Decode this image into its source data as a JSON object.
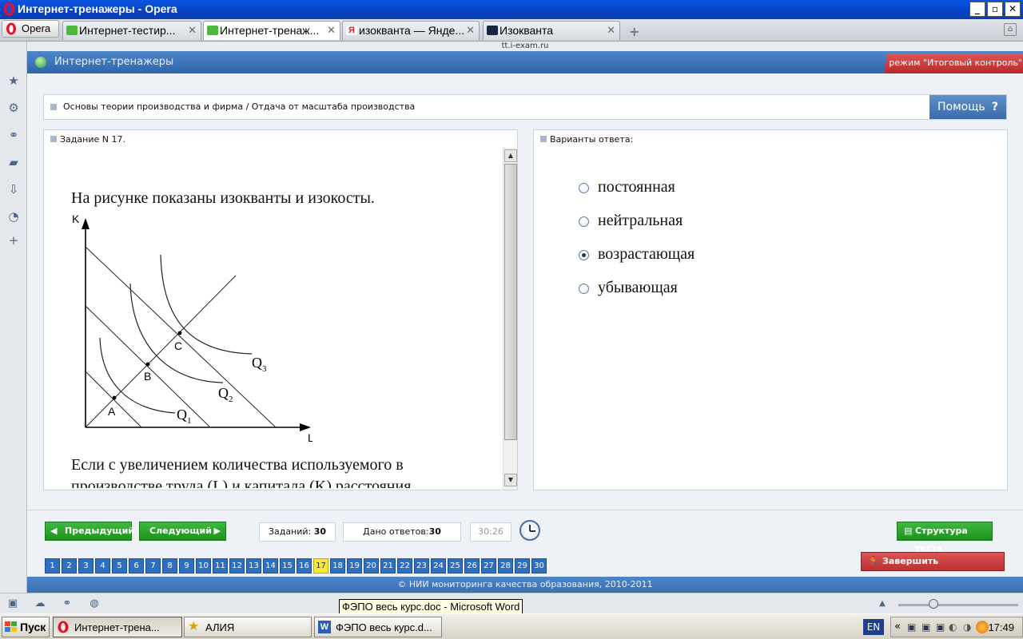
{
  "window": {
    "title": "Интернет-тренажеры - Opera",
    "controls": [
      "_",
      "▫",
      "✕"
    ]
  },
  "browser": {
    "menu_label": "Opera",
    "tabs": [
      {
        "label": "Интернет-тестир...",
        "icon": "green-page-icon"
      },
      {
        "label": "Интернет-тренаж...",
        "icon": "green-page-icon",
        "active": true
      },
      {
        "label": "изокванта — Янде...",
        "icon": "yandex-icon"
      },
      {
        "label": "Изокванта",
        "icon": "dark-page-icon"
      }
    ],
    "url": "tt.i-exam.ru"
  },
  "header": {
    "title": "Интернет-тренажеры",
    "mode": "режим \"Итоговый контроль\""
  },
  "topic": {
    "path": "Основы теории производства и фирма / Отдача от масштаба производства",
    "help_label": "Помощь",
    "help_icon": "?"
  },
  "question": {
    "header": "Задание N 17.",
    "intro": "На рисунке показаны изокванты и изокосты.",
    "tail_line1": "Если с увеличением количества используемого в",
    "tail_line2": "производстве труда (L) и капитала (K) расстояния",
    "figure": {
      "axis_y": "K",
      "axis_x": "L",
      "points": [
        "A",
        "B",
        "C"
      ],
      "curves": [
        "Q",
        "Q",
        "Q"
      ],
      "curve_subs": [
        "1",
        "2",
        "3"
      ]
    }
  },
  "answers": {
    "header": "Варианты ответа:",
    "options": [
      {
        "label": "постоянная",
        "selected": false
      },
      {
        "label": "нейтральная",
        "selected": false
      },
      {
        "label": "возрастающая",
        "selected": true
      },
      {
        "label": "убывающая",
        "selected": false
      }
    ]
  },
  "navigation": {
    "prev_label": "Предыдущий",
    "next_label": "Следующий",
    "tasks_label": "Заданий: ",
    "tasks_count": "30",
    "answered_label": "Дано ответов:",
    "answered_count": "30",
    "timer": "30:26",
    "structure_label": "Структура теста",
    "finish_label": "Завершить тестирование",
    "question_numbers": [
      "1",
      "2",
      "3",
      "4",
      "5",
      "6",
      "7",
      "8",
      "9",
      "10",
      "11",
      "12",
      "13",
      "14",
      "15",
      "16",
      "17",
      "18",
      "19",
      "20",
      "21",
      "22",
      "23",
      "24",
      "25",
      "26",
      "27",
      "28",
      "29",
      "30"
    ],
    "current": "17"
  },
  "footer": {
    "copyright": "© НИИ мониторинга качества образования, 2010-2011"
  },
  "statusbar": {
    "tooltip": "ФЭПО весь курс.doc - Microsoft Word"
  },
  "taskbar": {
    "start_label": "Пуск",
    "tasks": [
      {
        "label": "Интернет-трена...",
        "icon": "opera-icon",
        "active": true
      },
      {
        "label": "АЛИЯ",
        "icon": "star-icon"
      },
      {
        "label": "ФЭПО весь курс.d...",
        "icon": "word-icon"
      }
    ],
    "lang": "EN",
    "time": "17:49"
  },
  "colors": {
    "accent_blue": "#2f6fc0",
    "nav_green": "#1e8f1e",
    "finish_red": "#c73838",
    "current_question": "#f7e83b"
  }
}
